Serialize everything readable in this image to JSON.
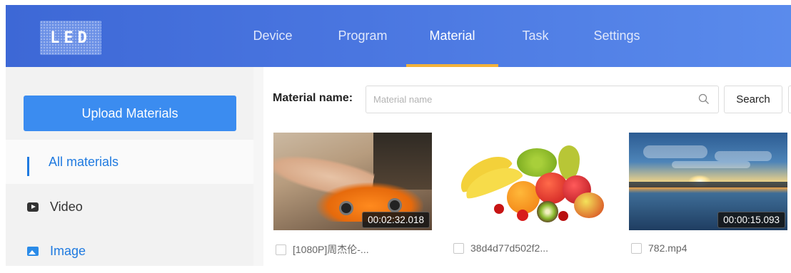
{
  "header": {
    "logo_text": "LED",
    "nav": [
      {
        "label": "Device"
      },
      {
        "label": "Program"
      },
      {
        "label": "Material",
        "active": true
      },
      {
        "label": "Task"
      },
      {
        "label": "Settings"
      }
    ],
    "colors": {
      "bar": "#4a76e0",
      "active_underline": "#f3b23a"
    }
  },
  "sidebar": {
    "upload_label": "Upload Materials",
    "items": [
      {
        "label": "All materials",
        "icon": "grid-icon",
        "active": true
      },
      {
        "label": "Video",
        "icon": "video-icon"
      },
      {
        "label": "Image",
        "icon": "image-icon"
      }
    ]
  },
  "search": {
    "label": "Material name:",
    "placeholder": "Material name",
    "value": "",
    "button_label": "Search"
  },
  "materials": [
    {
      "name": "[1080P]周杰伦-...",
      "duration": "00:02:32.018",
      "type": "video",
      "checked": false
    },
    {
      "name": "38d4d77d502f2...",
      "duration": "",
      "type": "image",
      "checked": false
    },
    {
      "name": "782.mp4",
      "duration": "00:00:15.093",
      "type": "video",
      "checked": false
    }
  ]
}
